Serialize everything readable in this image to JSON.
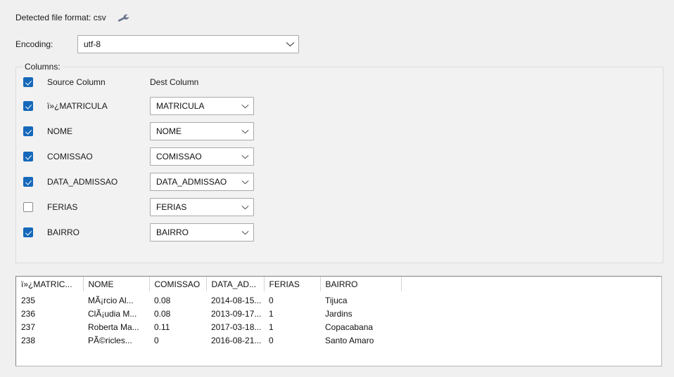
{
  "detected": {
    "label": "Detected file format: csv",
    "wrench_icon": "wrench-icon"
  },
  "encoding": {
    "label": "Encoding:",
    "value": "utf-8"
  },
  "columns_group": {
    "title": "Columns:",
    "header": {
      "source": "Source Column",
      "dest": "Dest Column",
      "checked": true
    },
    "rows": [
      {
        "checked": true,
        "source": "ï»¿MATRICULA",
        "dest": "MATRICULA"
      },
      {
        "checked": true,
        "source": "NOME",
        "dest": "NOME"
      },
      {
        "checked": true,
        "source": "COMISSAO",
        "dest": "COMISSAO"
      },
      {
        "checked": true,
        "source": "DATA_ADMISSAO",
        "dest": "DATA_ADMISSAO"
      },
      {
        "checked": false,
        "source": "FERIAS",
        "dest": "FERIAS"
      },
      {
        "checked": true,
        "source": "BAIRRO",
        "dest": "BAIRRO"
      }
    ]
  },
  "preview": {
    "headers": [
      "ï»¿MATRIC...",
      "NOME",
      "COMISSAO",
      "DATA_AD...",
      "FERIAS",
      "BAIRRO",
      ""
    ],
    "rows": [
      [
        "235",
        "MÃ¡rcio Al...",
        "0.08",
        "2014-08-15...",
        "0",
        "Tijuca",
        ""
      ],
      [
        "236",
        "ClÃ¡udia M...",
        "0.08",
        "2013-09-17...",
        "1",
        "Jardins",
        ""
      ],
      [
        "237",
        "Roberta Ma...",
        "0.11",
        "2017-03-18...",
        "1",
        "Copacabana",
        ""
      ],
      [
        "238",
        "PÃ©ricles...",
        "0",
        "2016-08-21...",
        "0",
        "Santo Amaro",
        ""
      ]
    ]
  },
  "colors": {
    "background": "#f0f0f0",
    "checkbox_accent": "#1668ba",
    "wrench": "#69758a",
    "grid_line": "#d6d6d6"
  }
}
